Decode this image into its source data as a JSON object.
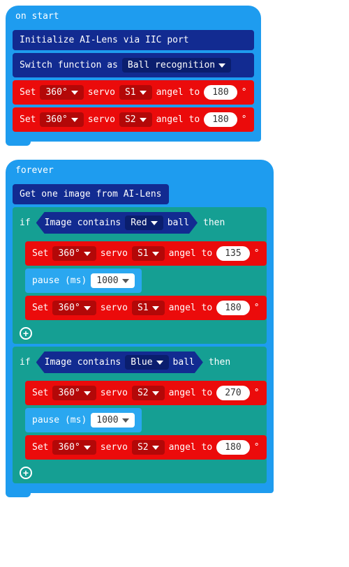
{
  "on_start": {
    "label": "on start",
    "init": "Initialize AI-Lens via IIC port",
    "switch_prefix": "Switch function as",
    "switch_option": "Ball recognition",
    "servo_set_1": {
      "set": "Set",
      "deg": "360°",
      "servo_word": "servo",
      "servo": "S1",
      "angle_word": "angel to",
      "val": "180",
      "unit": "°"
    },
    "servo_set_2": {
      "set": "Set",
      "deg": "360°",
      "servo_word": "servo",
      "servo": "S2",
      "angle_word": "angel to",
      "val": "180",
      "unit": "°"
    }
  },
  "forever": {
    "label": "forever",
    "get_image": "Get one image from AI-Lens",
    "if_word": "if",
    "then_word": "then",
    "img_contains": "Image contains",
    "ball_word": "ball",
    "red": "Red",
    "blue": "Blue",
    "red_s1_a": {
      "set": "Set",
      "deg": "360°",
      "servo_word": "servo",
      "servo": "S1",
      "angle_word": "angel to",
      "val": "135",
      "unit": "°"
    },
    "red_s1_b": {
      "set": "Set",
      "deg": "360°",
      "servo_word": "servo",
      "servo": "S1",
      "angle_word": "angel to",
      "val": "180",
      "unit": "°"
    },
    "blue_s2_a": {
      "set": "Set",
      "deg": "360°",
      "servo_word": "servo",
      "servo": "S2",
      "angle_word": "angel to",
      "val": "270",
      "unit": "°"
    },
    "blue_s2_b": {
      "set": "Set",
      "deg": "360°",
      "servo_word": "servo",
      "servo": "S2",
      "angle_word": "angel to",
      "val": "180",
      "unit": "°"
    },
    "pause_label": "pause (ms)",
    "pause_val": "1000"
  }
}
